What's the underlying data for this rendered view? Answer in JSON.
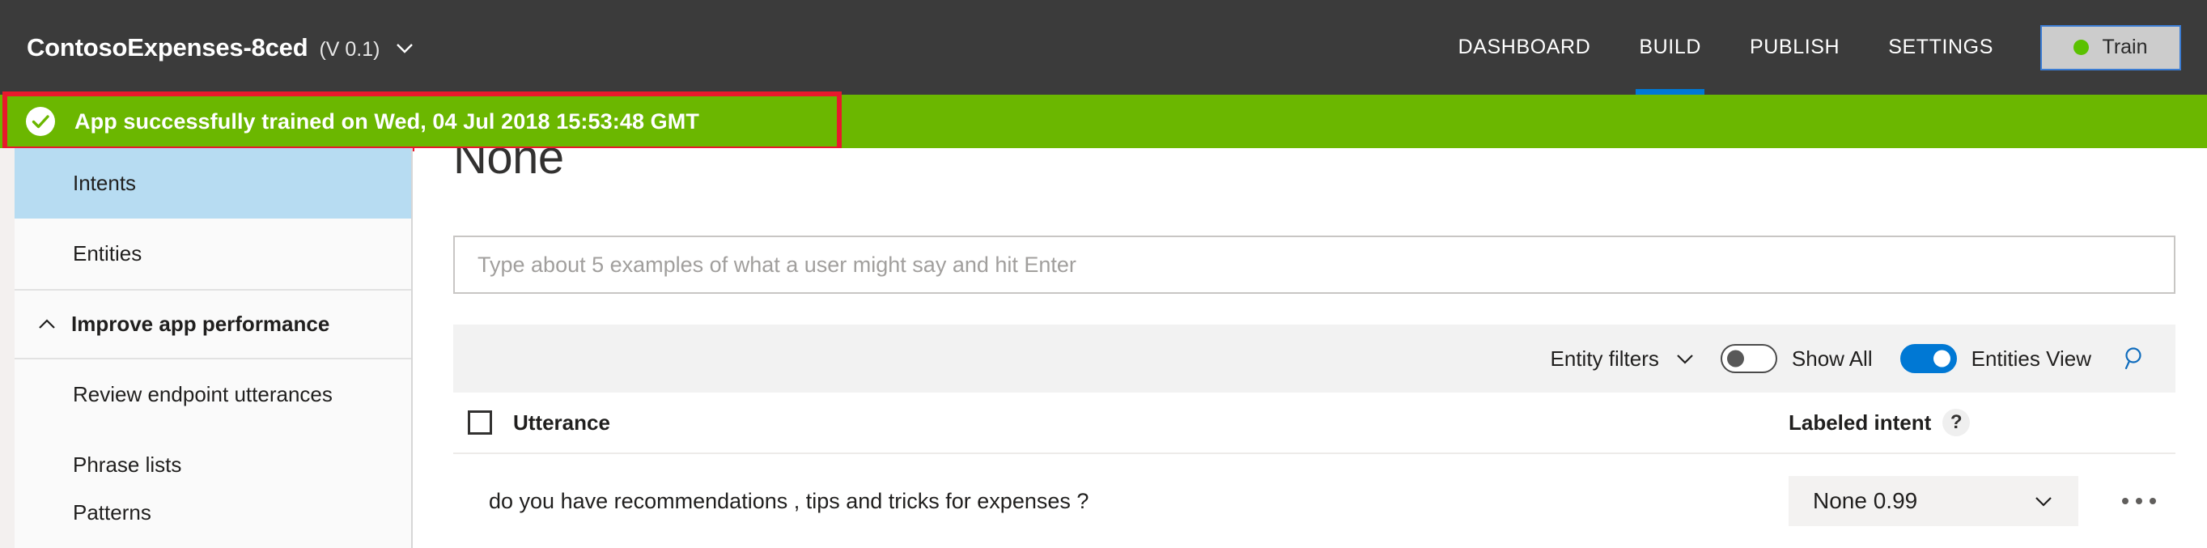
{
  "header": {
    "app_title": "ContosoExpenses-8ced",
    "app_version": "(V 0.1)",
    "version_chevron_icon": "chevron-down-icon",
    "nav": [
      {
        "label": "DASHBOARD",
        "active": false
      },
      {
        "label": "BUILD",
        "active": true
      },
      {
        "label": "PUBLISH",
        "active": false
      },
      {
        "label": "SETTINGS",
        "active": false
      }
    ],
    "train_button": {
      "label": "Train",
      "status_dot_color": "#5ac100",
      "background": "#cccccc",
      "focus_border": "#3b7cd3"
    },
    "background": "#3b3b3b",
    "active_tab_underline_color": "#0078d4"
  },
  "banner": {
    "icon": "check-circle-icon",
    "message": "App successfully trained on Wed, 04 Jul 2018 15:53:48 GMT",
    "background": "#6bb700",
    "text_color": "#ffffff"
  },
  "annotation": {
    "border_color": "#e8192c",
    "shape": "rectangle-highlight"
  },
  "sidebar": {
    "items": [
      {
        "label": "Intents",
        "selected": true,
        "type": "link"
      },
      {
        "label": "Entities",
        "selected": false,
        "type": "link"
      },
      {
        "label": "Improve app performance",
        "selected": false,
        "type": "group",
        "caret_icon": "chevron-up-icon"
      },
      {
        "label": "Review endpoint utterances",
        "selected": false,
        "type": "link"
      },
      {
        "label": "Phrase lists",
        "selected": false,
        "type": "link"
      },
      {
        "label": "Patterns",
        "selected": false,
        "type": "link"
      }
    ],
    "selected_background": "#b7dcf2"
  },
  "main": {
    "page_title": "None",
    "utterance_input": {
      "placeholder": "Type about 5 examples of what a user might say and hit Enter",
      "value": ""
    },
    "filter_bar": {
      "entity_filters_label": "Entity filters",
      "entity_filters_chevron_icon": "chevron-down-icon",
      "show_all_label": "Show All",
      "show_all_on": false,
      "entities_view_label": "Entities View",
      "entities_view_on": true,
      "search_icon": "search-icon",
      "toggle_on_color": "#0078d4",
      "background": "#f2f2f2"
    },
    "table": {
      "columns": {
        "select_all_checkbox": "select-all-checkbox",
        "utterance": "Utterance",
        "labeled_intent": "Labeled intent",
        "labeled_intent_help": "?"
      },
      "rows": [
        {
          "utterance": "do you have recommendations , tips and tricks for expenses ?",
          "labeled_intent": "None 0.99",
          "intent_chevron_icon": "chevron-down-icon",
          "more_icon": "ellipsis-icon"
        }
      ]
    }
  }
}
